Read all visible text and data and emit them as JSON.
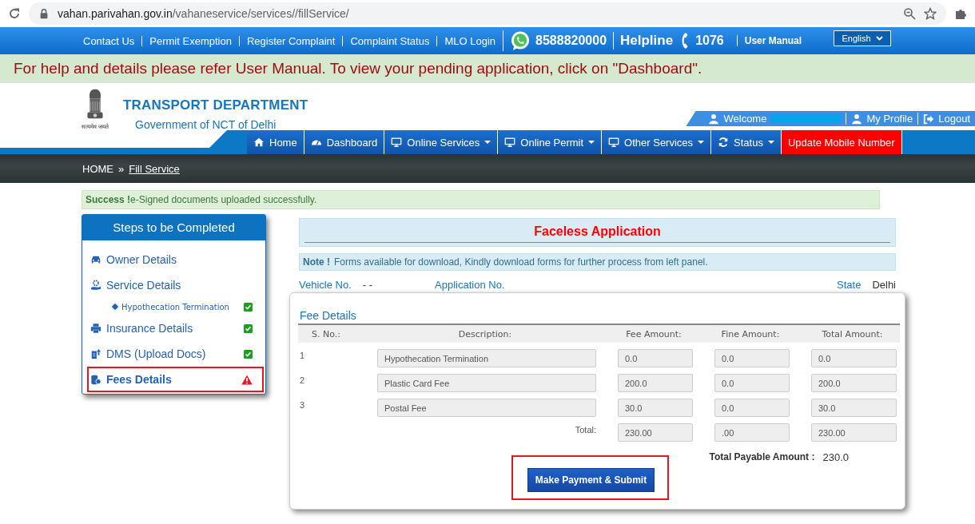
{
  "browser": {
    "host": "vahan.parivahan.gov.in",
    "path": "/vahaneservice/services//fillService/"
  },
  "top_links": [
    "Contact Us",
    "Permit Exemption",
    "Register Complaint",
    "Complaint Status",
    "MLO Login"
  ],
  "whatsapp": "8588820000",
  "helpline_label": "Helpline",
  "helpline": "1076",
  "user_manual": "User Manual",
  "language": "English",
  "banner": "For help and details please refer User Manual. To view your pending application, click on \"Dashboard\".",
  "header": {
    "title": "TRANSPORT DEPARTMENT",
    "subtitle": "Government of NCT of Delhi",
    "motto": "सत्यमेव जयते"
  },
  "user_bar": [
    {
      "label": "Welcome",
      "redacted": true
    },
    {
      "label": "My Profile",
      "redacted": false
    },
    {
      "label": "Logout",
      "redacted": false
    }
  ],
  "nav": [
    {
      "label": "Home",
      "dropdown": false,
      "kind": "normal"
    },
    {
      "label": "Dashboard",
      "dropdown": false,
      "kind": "normal"
    },
    {
      "label": "Online Services",
      "dropdown": true,
      "kind": "normal"
    },
    {
      "label": "Online Permit",
      "dropdown": true,
      "kind": "normal"
    },
    {
      "label": "Other Services",
      "dropdown": true,
      "kind": "normal"
    },
    {
      "label": "Status",
      "dropdown": true,
      "kind": "normal"
    },
    {
      "label": "Update Mobile Number",
      "dropdown": false,
      "kind": "alert"
    }
  ],
  "breadcrumb": {
    "home": "HOME",
    "separator": "»",
    "current": "Fill Service"
  },
  "alert": {
    "title": "Success !",
    "message": "e-Signed documents uploaded successfully."
  },
  "steps": {
    "title": "Steps to be Completed",
    "items": [
      {
        "label": "Owner Details",
        "checked": false,
        "warning": false,
        "highlighted": false
      },
      {
        "label": "Service Details",
        "checked": false,
        "warning": false,
        "highlighted": false,
        "children": [
          {
            "label": "Hypothecation Termination",
            "checked": true,
            "warning": false,
            "highlighted": false
          }
        ]
      },
      {
        "label": "Insurance Details",
        "checked": true,
        "warning": false,
        "highlighted": false
      },
      {
        "label": "DMS (Upload Docs)",
        "checked": true,
        "warning": false,
        "highlighted": false
      },
      {
        "label": "Fees Details",
        "checked": false,
        "warning": true,
        "highlighted": true
      }
    ]
  },
  "application": {
    "title": "Faceless Application",
    "note_label": "Note !",
    "note": "Forms available for download, Kindly download forms for further process from left panel.",
    "vehicle_label": "Vehicle No.",
    "vehicle_value": "- -",
    "application_label": "Application No.",
    "state_label": "State",
    "state_value": "Delhi"
  },
  "fees": {
    "title": "Fee Details",
    "columns": [
      "S. No.:",
      "Description:",
      "Fee Amount:",
      "Fine Amount:",
      "Total Amount:"
    ],
    "rows": [
      {
        "no": "1",
        "description": "Hypothecation Termination",
        "fee": "0.0",
        "fine": "0.0",
        "total": "0.0"
      },
      {
        "no": "2",
        "description": "Plastic Card Fee",
        "fee": "200.0",
        "fine": "0.0",
        "total": "200.0"
      },
      {
        "no": "3",
        "description": "Postal Fee",
        "fee": "30.0",
        "fine": "0.0",
        "total": "30.0"
      }
    ],
    "total_label": "Total:",
    "total_fee": "230.00",
    "total_fine": ".00",
    "total_total": "230.00",
    "payable_label": "Total Payable Amount :",
    "payable": "230.0",
    "submit": "Make Payment & Submit",
    "submit_highlighted": true
  }
}
